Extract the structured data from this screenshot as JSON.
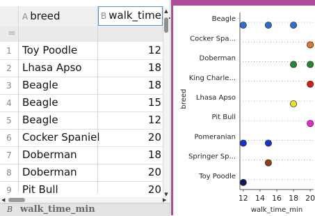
{
  "spreadsheet": {
    "columns": [
      {
        "letter": "A",
        "name": "breed"
      },
      {
        "letter": "B",
        "name": "walk_time..."
      }
    ],
    "formula_row_symbol": "=",
    "rows": [
      {
        "index": "1",
        "breed": "Toy Poodle",
        "walk_time": "12"
      },
      {
        "index": "2",
        "breed": "Lhasa Apso",
        "walk_time": "18"
      },
      {
        "index": "3",
        "breed": "Beagle",
        "walk_time": "18"
      },
      {
        "index": "4",
        "breed": "Beagle",
        "walk_time": "15"
      },
      {
        "index": "5",
        "breed": "Beagle",
        "walk_time": "12"
      },
      {
        "index": "6",
        "breed": "Cocker Spaniel",
        "walk_time": "20"
      },
      {
        "index": "7",
        "breed": "Doberman",
        "walk_time": "18"
      },
      {
        "index": "8",
        "breed": "Doberman",
        "walk_time": "20"
      },
      {
        "index": "9",
        "breed": "Pit Bull",
        "walk_time": "20"
      }
    ],
    "formula_bar": {
      "cell_ref": "B",
      "cell_name": "walk_time_min"
    }
  },
  "colors": {
    "accent": "#b04a9a",
    "selection": "#4a8fd6"
  },
  "chart_data": {
    "type": "scatter",
    "xlabel": "walk_time_min",
    "ylabel": "breed",
    "categories": [
      "Beagle",
      "Cocker Spa...",
      "Doberman",
      "King Charle...",
      "Lhasa Apso",
      "Pit Bull",
      "Pomeranian",
      "Springer Sp...",
      "Toy Poodle"
    ],
    "x_ticks": [
      "12",
      "14",
      "16",
      "18",
      "20"
    ],
    "xlim": [
      11.6,
      20.4
    ],
    "points": [
      {
        "category": "Beagle",
        "x": 12,
        "color": "#2b6fd6"
      },
      {
        "category": "Beagle",
        "x": 15,
        "color": "#2b6fd6"
      },
      {
        "category": "Beagle",
        "x": 18,
        "color": "#2b6fd6"
      },
      {
        "category": "Cocker Spa...",
        "x": 20,
        "color": "#e0782b"
      },
      {
        "category": "Doberman",
        "x": 18,
        "color": "#1e8a2e"
      },
      {
        "category": "Doberman",
        "x": 20,
        "color": "#1e8a2e"
      },
      {
        "category": "King Charle...",
        "x": 20,
        "color": "#e01818"
      },
      {
        "category": "Lhasa Apso",
        "x": 18,
        "color": "#f0e020"
      },
      {
        "category": "Pit Bull",
        "x": 20,
        "color": "#f020e0"
      },
      {
        "category": "Pomeranian",
        "x": 12,
        "color": "#1530d8"
      },
      {
        "category": "Pomeranian",
        "x": 15,
        "color": "#1530d8"
      },
      {
        "category": "Springer Sp...",
        "x": 15,
        "color": "#9a3c12"
      },
      {
        "category": "Toy Poodle",
        "x": 12,
        "color": "#0c1a66"
      }
    ]
  }
}
